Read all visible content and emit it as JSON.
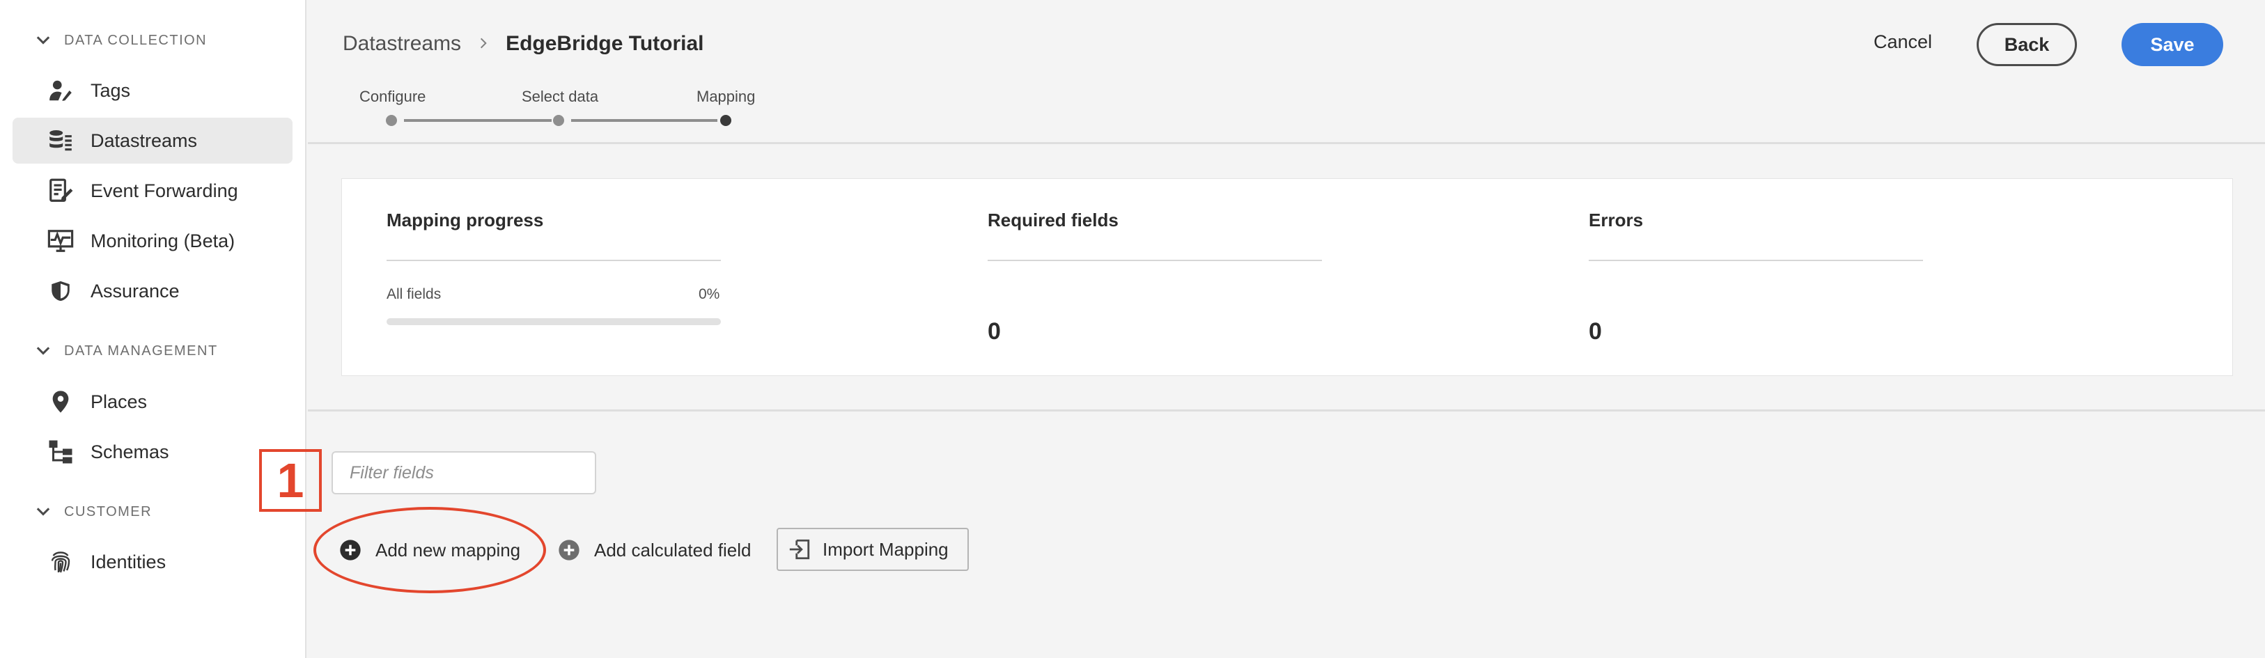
{
  "sidebar": {
    "sections": [
      {
        "title": "DATA COLLECTION",
        "items": [
          {
            "label": "Tags",
            "icon": "tags-icon"
          },
          {
            "label": "Datastreams",
            "icon": "datastreams-icon",
            "active": true
          },
          {
            "label": "Event Forwarding",
            "icon": "event-forwarding-icon"
          },
          {
            "label": "Monitoring (Beta)",
            "icon": "monitoring-icon"
          },
          {
            "label": "Assurance",
            "icon": "shield-icon"
          }
        ]
      },
      {
        "title": "DATA MANAGEMENT",
        "items": [
          {
            "label": "Places",
            "icon": "location-pin-icon"
          },
          {
            "label": "Schemas",
            "icon": "schema-icon"
          }
        ]
      },
      {
        "title": "CUSTOMER",
        "items": [
          {
            "label": "Identities",
            "icon": "fingerprint-icon"
          }
        ]
      }
    ]
  },
  "header": {
    "breadcrumb": {
      "parent": "Datastreams",
      "current": "EdgeBridge Tutorial"
    },
    "steps": [
      {
        "label": "Configure"
      },
      {
        "label": "Select data"
      },
      {
        "label": "Mapping",
        "current": true
      }
    ],
    "cancel_label": "Cancel",
    "back_label": "Back",
    "save_label": "Save"
  },
  "summary": {
    "mapping_progress": {
      "title": "Mapping progress",
      "all_fields_label": "All fields",
      "percent_text": "0%",
      "progress": 0
    },
    "required_fields": {
      "title": "Required fields",
      "value": "0"
    },
    "errors": {
      "title": "Errors",
      "value": "0"
    }
  },
  "filter": {
    "placeholder": "Filter fields",
    "value": ""
  },
  "actions": {
    "add_new_mapping": "Add new mapping",
    "add_calculated_field": "Add calculated field",
    "import_mapping": "Import Mapping"
  },
  "annotation": {
    "number": "1",
    "color": "#e3462d"
  },
  "colors": {
    "accent": "#3a7ddf",
    "sidebar_active": "#eaeaea",
    "background": "#f4f4f4"
  }
}
